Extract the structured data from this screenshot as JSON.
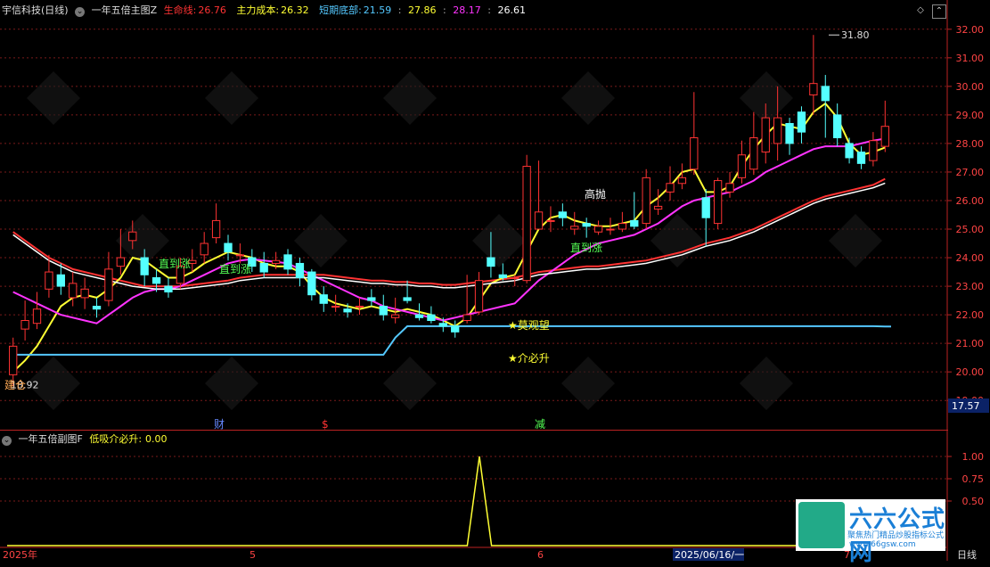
{
  "main_header": {
    "stock_name": "宇信科技(日线)",
    "indicator_name": "一年五倍主图Z",
    "life_line_label": "生命线:",
    "life_line_value": "26.76",
    "main_cost_label": "主力成本:",
    "main_cost_value": "26.32",
    "short_bottom_label": "短期底部:",
    "short_bottom_values": [
      "21.59",
      "27.86",
      "28.17",
      "26.61"
    ]
  },
  "sub_header": {
    "indicator_name": "一年五倍副图F",
    "signal_label": "低吸介必升:",
    "signal_value": "0.00"
  },
  "colors": {
    "up": "#ff3333",
    "down": "#54ffff",
    "life_line": "#ff3333",
    "main_cost": "#ffff33",
    "short_bottom": "#54c8ff",
    "magenta": "#ff33ff",
    "white": "#ffffff"
  },
  "price_axis": {
    "ticks": [
      "32.00",
      "31.00",
      "30.00",
      "29.00",
      "28.00",
      "27.00",
      "26.00",
      "25.00",
      "24.00",
      "23.00",
      "22.00",
      "21.00",
      "20.00",
      "19.00"
    ],
    "last_price_box": "17.57"
  },
  "sub_axis": {
    "ticks": [
      "1.00",
      "0.75",
      "0.50"
    ]
  },
  "chart_annotations": {
    "high_label": "31.80",
    "low_label": "18.92",
    "labels": [
      "建仓",
      "直到涨",
      "直到涨",
      "高抛",
      "直到涨",
      "★莫观望",
      "★介必升"
    ]
  },
  "event_markers": [
    "财",
    "$",
    "减"
  ],
  "date_axis": {
    "labels": [
      "2025年",
      "5",
      "6",
      "2025/06/16/一",
      "7"
    ],
    "period_label": "日线"
  },
  "chart_data": {
    "type": "candlestick",
    "title": "宇信科技(日线)",
    "xlabel": "",
    "ylabel": "",
    "ylim": [
      18.6,
      32.4
    ],
    "candles": [
      [
        19.9,
        20.9,
        21.2,
        19.5
      ],
      [
        21.5,
        21.8,
        22.5,
        21.1
      ],
      [
        21.7,
        22.2,
        22.8,
        21.5
      ],
      [
        22.9,
        23.5,
        24.1,
        22.6
      ],
      [
        23.4,
        23.0,
        23.8,
        22.7
      ],
      [
        22.6,
        23.1,
        23.5,
        22.3
      ],
      [
        22.6,
        22.9,
        23.3,
        22.2
      ],
      [
        22.3,
        22.2,
        22.6,
        21.9
      ],
      [
        22.5,
        23.6,
        24.2,
        22.3
      ],
      [
        23.7,
        24.0,
        25.0,
        23.4
      ],
      [
        24.6,
        24.9,
        25.3,
        24.3
      ],
      [
        24.0,
        23.4,
        24.3,
        23.0
      ],
      [
        23.3,
        23.1,
        23.6,
        22.8
      ],
      [
        23.0,
        22.8,
        23.3,
        22.6
      ],
      [
        23.1,
        23.7,
        24.0,
        22.9
      ],
      [
        23.8,
        23.9,
        24.3,
        23.5
      ],
      [
        24.1,
        24.5,
        24.9,
        23.8
      ],
      [
        24.7,
        25.3,
        25.9,
        24.5
      ],
      [
        24.5,
        24.2,
        24.8,
        23.9
      ],
      [
        24.1,
        24.1,
        24.5,
        23.8
      ],
      [
        24.0,
        23.7,
        24.3,
        23.5
      ],
      [
        23.8,
        23.5,
        24.2,
        23.3
      ],
      [
        23.8,
        23.9,
        24.2,
        23.6
      ],
      [
        24.1,
        23.6,
        24.3,
        23.4
      ],
      [
        23.8,
        23.3,
        24.0,
        23.0
      ],
      [
        23.5,
        22.7,
        23.6,
        22.5
      ],
      [
        22.7,
        22.4,
        23.0,
        22.1
      ],
      [
        22.3,
        22.3,
        22.7,
        22.1
      ],
      [
        22.2,
        22.1,
        22.4,
        21.9
      ],
      [
        22.3,
        22.3,
        22.6,
        22.0
      ],
      [
        22.6,
        22.5,
        22.9,
        22.3
      ],
      [
        22.3,
        22.0,
        22.7,
        21.8
      ],
      [
        21.9,
        22.0,
        22.6,
        21.7
      ],
      [
        22.6,
        22.5,
        23.2,
        22.4
      ],
      [
        22.0,
        21.9,
        22.4,
        21.8
      ],
      [
        22.0,
        21.8,
        22.3,
        21.7
      ],
      [
        21.7,
        21.6,
        21.9,
        21.4
      ],
      [
        21.6,
        21.4,
        21.8,
        21.2
      ],
      [
        21.8,
        22.0,
        23.4,
        21.7
      ],
      [
        22.1,
        23.2,
        23.5,
        22.0
      ],
      [
        24.0,
        23.7,
        24.9,
        23.3
      ],
      [
        23.4,
        23.3,
        23.8,
        23.2
      ],
      [
        23.3,
        23.3,
        23.4,
        23.0
      ],
      [
        23.2,
        27.2,
        27.6,
        23.1
      ],
      [
        25.0,
        25.6,
        27.4,
        25.0
      ],
      [
        25.3,
        25.3,
        25.8,
        24.9
      ],
      [
        25.6,
        25.4,
        25.9,
        25.1
      ],
      [
        25.0,
        25.1,
        25.6,
        24.8
      ],
      [
        25.2,
        25.1,
        25.4,
        24.7
      ],
      [
        24.9,
        25.1,
        25.3,
        24.8
      ],
      [
        25.0,
        25.0,
        25.4,
        24.8
      ],
      [
        25.0,
        25.2,
        25.6,
        24.9
      ],
      [
        25.3,
        25.1,
        26.3,
        25.0
      ],
      [
        25.2,
        26.8,
        27.1,
        25.0
      ],
      [
        25.7,
        25.8,
        26.4,
        25.5
      ],
      [
        26.3,
        26.6,
        27.2,
        26.0
      ],
      [
        26.6,
        26.8,
        27.3,
        26.4
      ],
      [
        27.1,
        28.2,
        29.8,
        26.9
      ],
      [
        26.1,
        25.4,
        26.4,
        24.4
      ],
      [
        25.2,
        26.7,
        26.8,
        25.0
      ],
      [
        26.3,
        26.6,
        27.0,
        26.1
      ],
      [
        26.8,
        27.6,
        28.1,
        26.6
      ],
      [
        27.1,
        28.2,
        29.1,
        26.9
      ],
      [
        27.7,
        28.9,
        29.4,
        27.3
      ],
      [
        28.0,
        28.9,
        30.0,
        27.4
      ],
      [
        28.7,
        28.0,
        28.9,
        27.6
      ],
      [
        29.1,
        28.4,
        29.3,
        28.0
      ],
      [
        29.7,
        30.1,
        31.8,
        29.0
      ],
      [
        30.0,
        29.5,
        30.4,
        28.2
      ],
      [
        29.0,
        28.2,
        29.4,
        27.9
      ],
      [
        28.0,
        27.5,
        28.2,
        27.3
      ],
      [
        27.7,
        27.3,
        27.9,
        27.1
      ],
      [
        27.4,
        28.1,
        28.4,
        27.2
      ],
      [
        27.9,
        28.6,
        29.5,
        27.7
      ]
    ],
    "series": [
      {
        "name": "生命线",
        "values": [
          24.9,
          24.6,
          24.3,
          24.0,
          23.8,
          23.6,
          23.5,
          23.4,
          23.3,
          23.2,
          23.1,
          23.0,
          23.0,
          23.0,
          23.0,
          23.05,
          23.1,
          23.15,
          23.2,
          23.3,
          23.35,
          23.4,
          23.4,
          23.4,
          23.4,
          23.4,
          23.4,
          23.35,
          23.3,
          23.25,
          23.2,
          23.2,
          23.15,
          23.15,
          23.1,
          23.1,
          23.05,
          23.05,
          23.1,
          23.15,
          23.2,
          23.25,
          23.3,
          23.4,
          23.5,
          23.55,
          23.6,
          23.65,
          23.7,
          23.7,
          23.75,
          23.8,
          23.85,
          23.9,
          24.0,
          24.1,
          24.2,
          24.35,
          24.5,
          24.6,
          24.7,
          24.85,
          25.0,
          25.2,
          25.4,
          25.6,
          25.8,
          26.0,
          26.15,
          26.25,
          26.35,
          26.45,
          26.55,
          26.76
        ]
      },
      {
        "name": "主力成本",
        "values": [
          20.0,
          20.4,
          20.9,
          21.6,
          22.3,
          22.6,
          22.7,
          22.6,
          22.9,
          23.3,
          24.0,
          23.9,
          23.6,
          23.3,
          23.3,
          23.5,
          23.8,
          24.0,
          24.2,
          24.1,
          24.0,
          23.8,
          23.7,
          23.7,
          23.5,
          23.0,
          22.6,
          22.4,
          22.3,
          22.2,
          22.3,
          22.2,
          22.1,
          22.2,
          22.1,
          22.0,
          21.8,
          21.6,
          21.9,
          22.5,
          23.1,
          23.3,
          23.4,
          24.2,
          25.0,
          25.4,
          25.5,
          25.3,
          25.2,
          25.1,
          25.1,
          25.2,
          25.3,
          25.8,
          26.1,
          26.5,
          27.0,
          27.1,
          26.3,
          26.3,
          26.5,
          27.2,
          27.8,
          28.3,
          28.7,
          28.6,
          28.5,
          29.1,
          29.4,
          28.9,
          28.0,
          27.6,
          27.7,
          27.86
        ]
      },
      {
        "name": "短期底部",
        "values": [
          20.6,
          20.6,
          20.6,
          20.6,
          20.6,
          20.6,
          20.6,
          20.6,
          20.6,
          20.6,
          20.6,
          20.6,
          20.6,
          20.6,
          20.6,
          20.6,
          20.6,
          20.6,
          20.6,
          20.6,
          20.6,
          20.6,
          20.6,
          20.6,
          20.6,
          20.6,
          20.6,
          20.6,
          20.6,
          20.6,
          20.6,
          20.6,
          21.2,
          21.6,
          21.6,
          21.6,
          21.6,
          21.6,
          21.6,
          21.6,
          21.6,
          21.6,
          21.6,
          21.6,
          21.6,
          21.6,
          21.6,
          21.6,
          21.6,
          21.6,
          21.6,
          21.6,
          21.6,
          21.6,
          21.6,
          21.6,
          21.6,
          21.6,
          21.6,
          21.6,
          21.6,
          21.6,
          21.6,
          21.6,
          21.6,
          21.6,
          21.6,
          21.6,
          21.6,
          21.6,
          21.6,
          21.6,
          21.6,
          21.59
        ]
      },
      {
        "name": "",
        "values": [
          22.8,
          22.6,
          22.4,
          22.2,
          22.0,
          21.9,
          21.8,
          21.7,
          22.0,
          22.3,
          22.6,
          22.8,
          22.9,
          22.9,
          23.0,
          23.2,
          23.4,
          23.6,
          23.8,
          23.9,
          23.95,
          23.9,
          23.85,
          23.8,
          23.6,
          23.4,
          23.2,
          23.0,
          22.8,
          22.6,
          22.5,
          22.3,
          22.2,
          22.1,
          22.0,
          21.9,
          21.8,
          21.9,
          22.0,
          22.1,
          22.2,
          22.3,
          22.4,
          22.8,
          23.2,
          23.5,
          23.8,
          24.1,
          24.3,
          24.5,
          24.6,
          24.7,
          24.8,
          25.0,
          25.2,
          25.5,
          25.8,
          26.0,
          26.1,
          26.2,
          26.3,
          26.5,
          26.7,
          27.0,
          27.2,
          27.4,
          27.6,
          27.8,
          27.9,
          27.9,
          27.9,
          28.0,
          28.1,
          28.17
        ]
      },
      {
        "name": "",
        "values": [
          24.8,
          24.5,
          24.2,
          23.9,
          23.7,
          23.5,
          23.4,
          23.3,
          23.2,
          23.1,
          23.0,
          22.95,
          22.9,
          22.9,
          22.9,
          22.95,
          23.0,
          23.05,
          23.1,
          23.2,
          23.25,
          23.3,
          23.3,
          23.3,
          23.3,
          23.3,
          23.3,
          23.25,
          23.2,
          23.15,
          23.1,
          23.1,
          23.05,
          23.05,
          23.0,
          23.0,
          22.95,
          22.95,
          23.0,
          23.05,
          23.1,
          23.15,
          23.2,
          23.3,
          23.4,
          23.45,
          23.5,
          23.55,
          23.6,
          23.6,
          23.65,
          23.7,
          23.75,
          23.8,
          23.9,
          24.0,
          24.1,
          24.25,
          24.4,
          24.5,
          24.6,
          24.75,
          24.9,
          25.1,
          25.3,
          25.5,
          25.7,
          25.9,
          26.05,
          26.15,
          26.25,
          26.35,
          26.45,
          26.61
        ]
      }
    ],
    "sub_chart": {
      "type": "line",
      "ylim": [
        0,
        1.15
      ],
      "values": [
        0,
        0,
        0,
        0,
        0,
        0,
        0,
        0,
        0,
        0,
        0,
        0,
        0,
        0,
        0,
        0,
        0,
        0,
        0,
        0,
        0,
        0,
        0,
        0,
        0,
        0,
        0,
        0,
        0,
        0,
        0,
        0,
        0,
        0,
        0,
        0,
        0,
        0,
        0,
        1,
        0,
        0,
        0,
        0,
        0,
        0,
        0,
        0,
        0,
        0,
        0,
        0,
        0,
        0,
        0,
        0,
        0,
        0,
        0,
        0,
        0,
        0,
        0,
        0,
        0,
        0,
        0,
        0,
        0,
        0,
        0,
        0,
        0,
        0
      ]
    }
  }
}
